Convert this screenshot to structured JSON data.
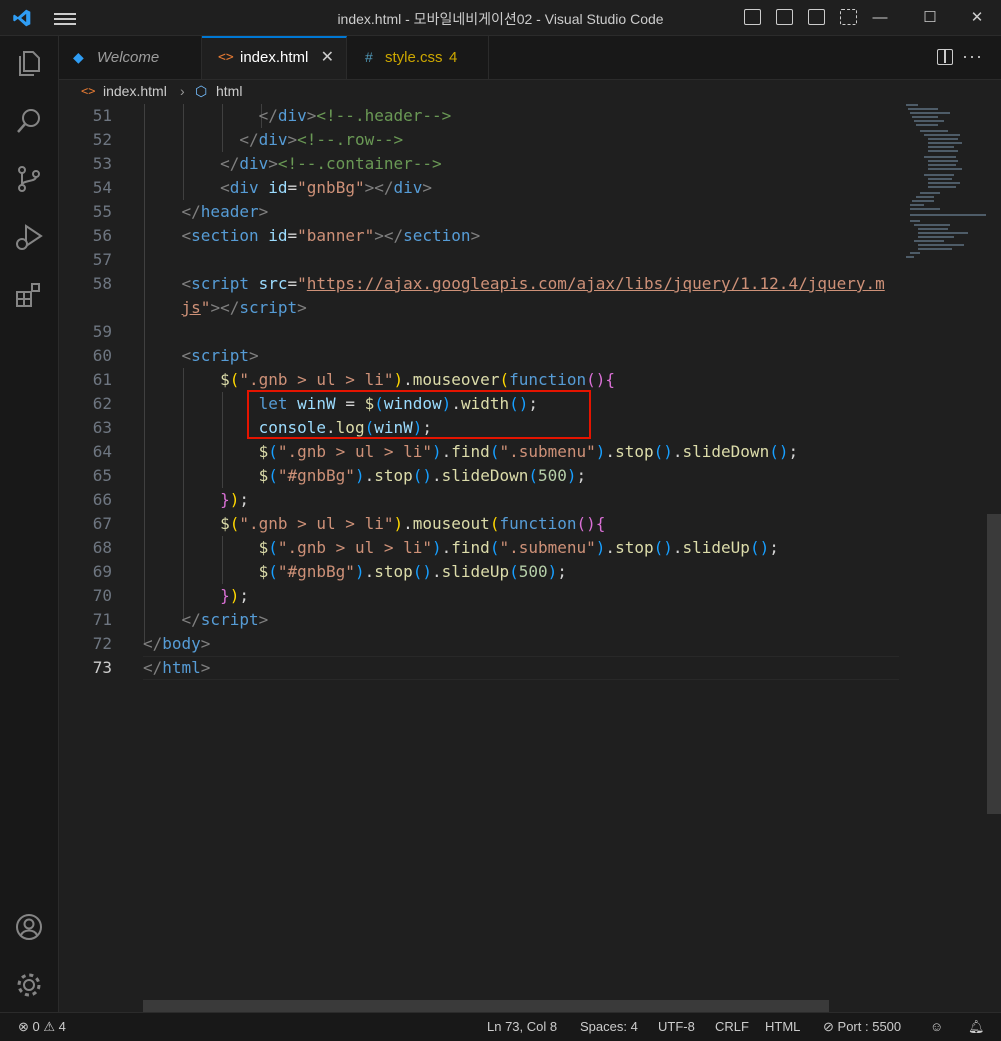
{
  "window": {
    "title": "index.html - 모바일네비게이션02 - Visual Studio Code"
  },
  "tabs": [
    {
      "label": "Welcome",
      "icon": "vscode-icon"
    },
    {
      "label": "index.html",
      "icon": "html-icon",
      "active": true
    },
    {
      "label": "style.css",
      "icon": "css-icon",
      "badge": "4"
    }
  ],
  "breadcrumb": {
    "file": "index.html",
    "symbol": "html"
  },
  "editor": {
    "line_numbers": [
      "51",
      "52",
      "53",
      "54",
      "55",
      "56",
      "57",
      "58",
      "",
      "59",
      "60",
      "61",
      "62",
      "63",
      "64",
      "65",
      "66",
      "67",
      "68",
      "69",
      "70",
      "71",
      "72",
      "73"
    ],
    "current_line": "73"
  },
  "status": {
    "errors": "0",
    "warnings": "4",
    "position": "Ln 73, Col 8",
    "spaces": "Spaces: 4",
    "encoding": "UTF-8",
    "eol": "CRLF",
    "language": "HTML",
    "port": "Port : 5500"
  },
  "colors": {
    "accent": "#0078d4",
    "highlight_box": "#e51400",
    "background": "#1f1f1f"
  }
}
